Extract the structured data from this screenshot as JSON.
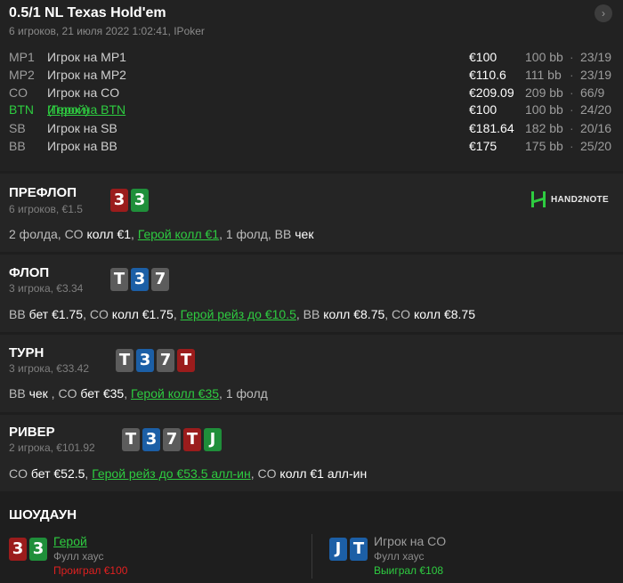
{
  "header": {
    "title": "0.5/1 NL Texas Hold'em",
    "subtitle": "6 игроков, 21 июля 2022 1:02:41, IPoker",
    "nav_icon": "›"
  },
  "players": [
    {
      "pos": "MP1",
      "name": "Игрок на MP1",
      "stack": "€100",
      "bb": "100 bb",
      "dot": "·",
      "hud": "23/19"
    },
    {
      "pos": "MP2",
      "name": "Игрок на MP2",
      "stack": "€110.6",
      "bb": "111 bb",
      "dot": "·",
      "hud": "23/19"
    },
    {
      "pos": "CO",
      "name": "Игрок на CO",
      "stack": "€209.09",
      "bb": "209 bb",
      "dot": "·",
      "hud": "66/9"
    },
    {
      "pos": "BTN",
      "name": "Игрок на BTN",
      "name_suffix": " (Герой)",
      "stack": "€100",
      "bb": "100 bb",
      "dot": "·",
      "hud": "24/20"
    },
    {
      "pos": "SB",
      "name": "Игрок на SB",
      "stack": "€181.64",
      "bb": "182 bb",
      "dot": "·",
      "hud": "20/16"
    },
    {
      "pos": "BB",
      "name": "Игрок на BB",
      "stack": "€175",
      "bb": "175 bb",
      "dot": "·",
      "hud": "25/20"
    }
  ],
  "logo_text": "HAND2NOTE",
  "colors": {
    "hero": "#2ecc40",
    "lost": "#e02020",
    "card_red": "#9b1c1c",
    "card_green": "#1f8f3a",
    "card_blue": "#1c5fa6",
    "card_gray": "#5c5c5c"
  },
  "preflop": {
    "title": "ПРЕФЛОП",
    "sub": "6 игроков, €1.5",
    "cards": [
      "3",
      "3"
    ],
    "action": {
      "a": "2 фолда, CO ",
      "b": "колл €1",
      "c": ", ",
      "hero": "Герой колл €1",
      "d": ", 1 фолд, BB ",
      "e": "чек"
    }
  },
  "flop": {
    "title": "ФЛОП",
    "sub": "3 игрока, €3.34",
    "cards": [
      "T",
      "3",
      "7"
    ],
    "action": {
      "a": "BB ",
      "b": "бет €1.75",
      "c": ", CO ",
      "d": "колл €1.75",
      "e": ", ",
      "hero": "Герой рейз до €10.5",
      "f": ", BB ",
      "g": "колл €8.75",
      "h": ", CO ",
      "i": "колл €8.75"
    }
  },
  "turn": {
    "title": "ТУРН",
    "sub": "3 игрока, €33.42",
    "cards": [
      "T",
      "3",
      "7",
      "T"
    ],
    "action": {
      "a": "BB ",
      "b": "чек",
      "c": " , CO ",
      "d": "бет €35",
      "e": ", ",
      "hero": "Герой колл €35",
      "f": ", 1 фолд"
    }
  },
  "river": {
    "title": "РИВЕР",
    "sub": "2 игрока, €101.92",
    "cards": [
      "T",
      "3",
      "7",
      "T",
      "J"
    ],
    "action": {
      "a": "CO ",
      "b": "бет €52.5",
      "c": ", ",
      "hero": "Герой рейз до €53.5 алл-ин",
      "d": ", CO ",
      "e": "колл €1 алл-ин"
    }
  },
  "showdown": {
    "title": "ШОУДАУН",
    "hero": {
      "cards": [
        "3",
        "3"
      ],
      "name": "Герой",
      "hand": "Фулл хаус",
      "result": "Проиграл €100"
    },
    "villain": {
      "cards": [
        "J",
        "T"
      ],
      "name": "Игрок на CO",
      "hand": "Фулл хаус",
      "result": "Выиграл €108"
    }
  }
}
